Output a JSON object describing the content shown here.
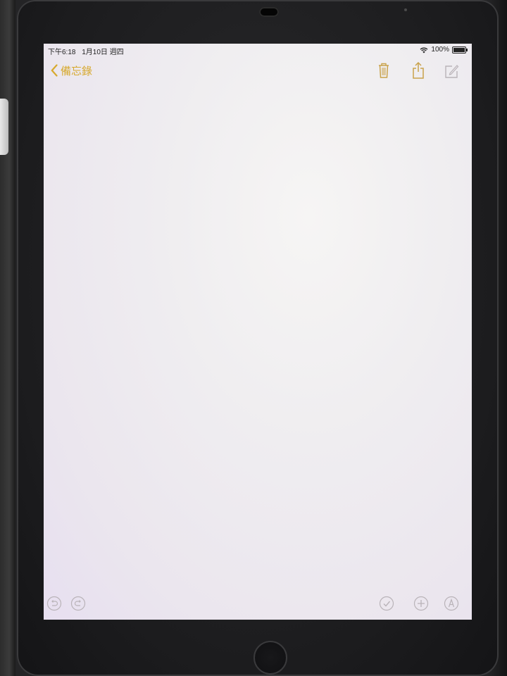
{
  "status_bar": {
    "time": "下午6:18",
    "date": "1月10日 週四",
    "battery": "100%"
  },
  "nav": {
    "back_label": "備忘錄",
    "icons": [
      "trash-icon",
      "share-icon",
      "compose-icon"
    ]
  },
  "note": {
    "content": ""
  },
  "toolbar": {
    "icons": [
      "undo-icon",
      "redo-icon",
      "checklist-icon",
      "add-icon",
      "markup-icon"
    ]
  },
  "colors": {
    "accent": "#d7a92e",
    "icon_gray": "#b9b3b8",
    "screen_bg": "#efedf0",
    "device_frame": "#1c1c1e"
  }
}
